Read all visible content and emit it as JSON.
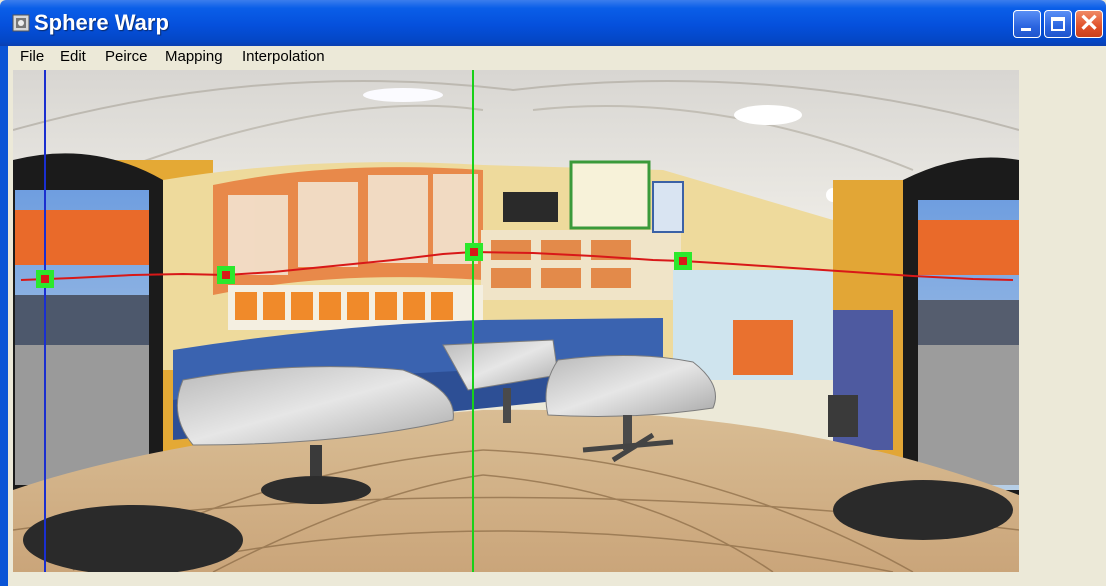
{
  "window": {
    "title": "Sphere Warp",
    "icon": "app-icon",
    "controls": [
      "minimize-icon",
      "maximize-icon",
      "close-icon"
    ],
    "close_glyph": "✕"
  },
  "menu": {
    "items": [
      "File",
      "Edit",
      "Peirce",
      "Mapping",
      "Interpolation"
    ]
  },
  "canvas": {
    "image": "panorama-cafe-interior",
    "overlay_colors": {
      "vertical_guide_left": "#1a2fd0",
      "vertical_guide_center": "#18d018",
      "warp_curve": "#d81818",
      "control_point_outer": "#2ce82c",
      "control_point_inner": "#d81818"
    },
    "control_point_count": 4
  },
  "colors": {
    "titlebar": "#0550dc",
    "chrome": "#ece9d8",
    "close_button": "#e0512a"
  }
}
